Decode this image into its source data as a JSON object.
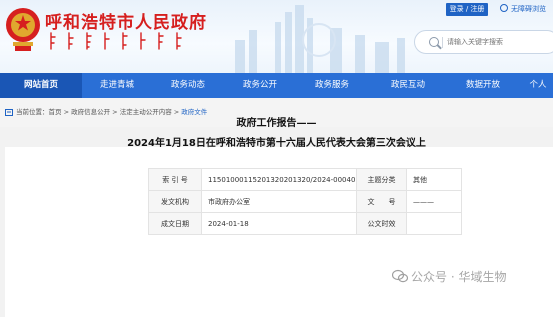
{
  "header": {
    "site_title": "呼和浩特市人民政府",
    "login_label": "登录 / 注册",
    "accessibility_label": "无障碍浏览",
    "search_placeholder": "请输入关键字搜索"
  },
  "nav": {
    "items": [
      {
        "label": "网站首页",
        "active": true
      },
      {
        "label": "走进青城"
      },
      {
        "label": "政务动态"
      },
      {
        "label": "政务公开"
      },
      {
        "label": "政务服务"
      },
      {
        "label": "政民互动"
      },
      {
        "label": "数据开放"
      },
      {
        "label": "个人"
      }
    ]
  },
  "breadcrumb": {
    "prefix": "当前位置：",
    "items": [
      "首页",
      "政府信息公开",
      "法定主动公开内容",
      "政府文件"
    ],
    "separator": " > "
  },
  "meta": {
    "index_label": "索 引 号",
    "index_value": "115010001152013202013​20/2024-00040",
    "topic_label": "主题分类",
    "topic_value": "其他",
    "issuer_label": "发文机构",
    "issuer_value": "市政府办公室",
    "docno_label": "文　　号",
    "docno_value": "———",
    "date_label": "成文日期",
    "date_value": "2024-01-18",
    "pubtime_label": "公文时效",
    "pubtime_value": ""
  },
  "document": {
    "title": "政府工作报告——",
    "subtitle": "2024年1月18日在呼和浩特市第十六届人民代表大会第三次会议上"
  },
  "watermark": {
    "text": "公众号 · 华域生物"
  },
  "colors": {
    "brand_red": "#d61f1f",
    "nav_blue": "#2a6fd6",
    "nav_active": "#1a56b5",
    "link_blue": "#1f63c4"
  }
}
